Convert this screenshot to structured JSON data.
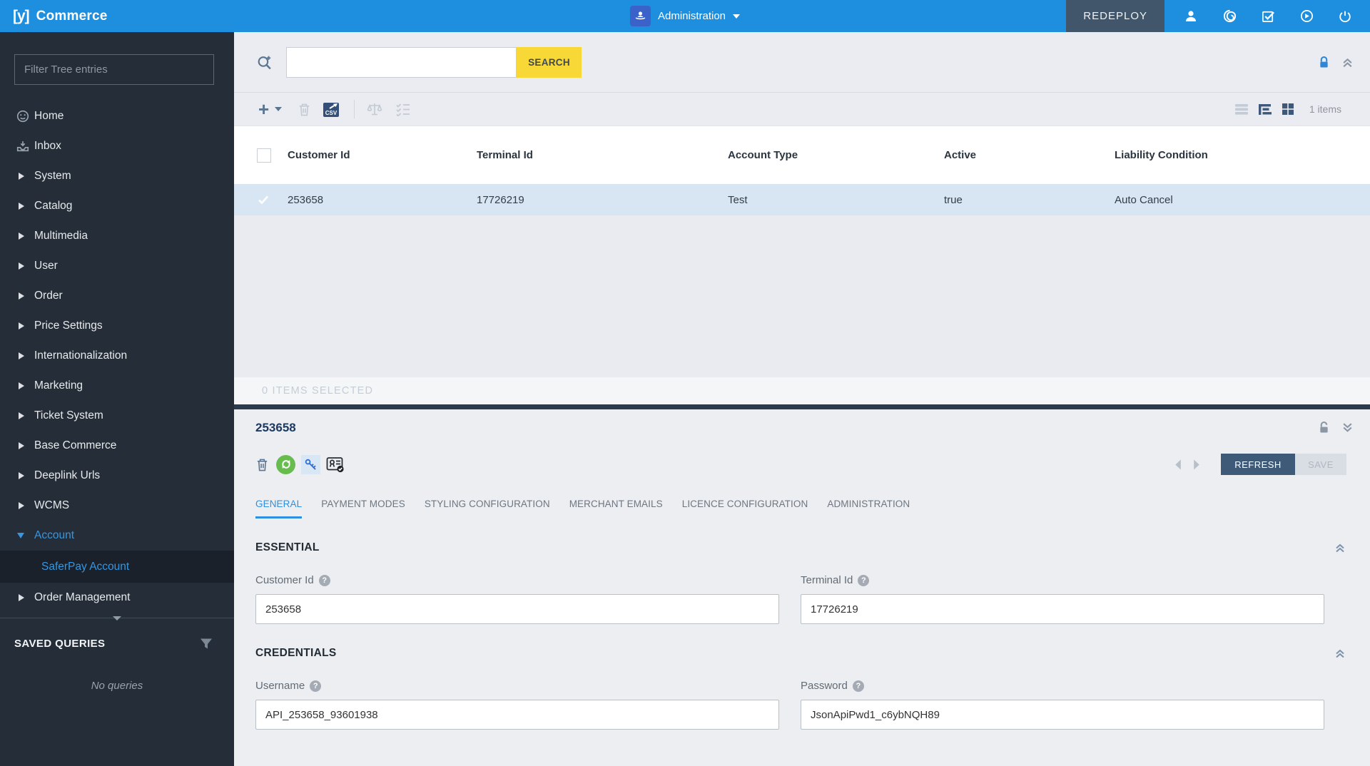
{
  "topbar": {
    "logo": "[y]",
    "brand": "Commerce",
    "perspective_label": "Administration",
    "redeploy_label": "REDEPLOY"
  },
  "sidebar": {
    "filter_placeholder": "Filter Tree entries",
    "tree": [
      {
        "label": "Home"
      },
      {
        "label": "Inbox"
      },
      {
        "label": "System"
      },
      {
        "label": "Catalog"
      },
      {
        "label": "Multimedia"
      },
      {
        "label": "User"
      },
      {
        "label": "Order"
      },
      {
        "label": "Price Settings"
      },
      {
        "label": "Internationalization"
      },
      {
        "label": "Marketing"
      },
      {
        "label": "Ticket System"
      },
      {
        "label": "Base Commerce"
      },
      {
        "label": "Deeplink Urls"
      },
      {
        "label": "WCMS"
      },
      {
        "label": "Account",
        "children": [
          {
            "label": "SaferPay Account"
          }
        ]
      },
      {
        "label": "Order Management"
      }
    ],
    "saved_queries_title": "SAVED QUERIES",
    "no_queries": "No queries"
  },
  "search": {
    "value": "",
    "button_label": "SEARCH"
  },
  "toolbar": {
    "count_label": "1 items"
  },
  "table": {
    "columns": [
      "Customer Id",
      "Terminal Id",
      "Account Type",
      "Active",
      "Liability Condition"
    ],
    "rows": [
      [
        "253658",
        "17726219",
        "Test",
        "true",
        "Auto Cancel"
      ]
    ],
    "selection_status": "0 ITEMS SELECTED"
  },
  "editor": {
    "title": "253658",
    "refresh_label": "REFRESH",
    "save_label": "SAVE",
    "tabs": [
      "GENERAL",
      "PAYMENT MODES",
      "STYLING CONFIGURATION",
      "MERCHANT EMAILS",
      "LICENCE CONFIGURATION",
      "ADMINISTRATION"
    ],
    "sections": {
      "essential": {
        "title": "ESSENTIAL",
        "customer_id": {
          "label": "Customer Id",
          "value": "253658"
        },
        "terminal_id": {
          "label": "Terminal Id",
          "value": "17726219"
        }
      },
      "credentials": {
        "title": "CREDENTIALS",
        "username": {
          "label": "Username",
          "value": "API_253658_93601938"
        },
        "password": {
          "label": "Password",
          "value": "JsonApiPwd1_c6ybNQH89"
        }
      }
    }
  },
  "icons": {
    "help_glyph": "?",
    "plus_glyph": "+"
  },
  "colors": {
    "topbar_blue": "#1e8ede",
    "accent_blue": "#3696e0",
    "search_yellow": "#f7d836",
    "sidebar_dark": "#252e38",
    "selected_row_blue": "#d8e6f3",
    "refresh_navy": "#3e5a78",
    "sync_green": "#66bd4e",
    "divider_navy": "#2c3b4d"
  }
}
